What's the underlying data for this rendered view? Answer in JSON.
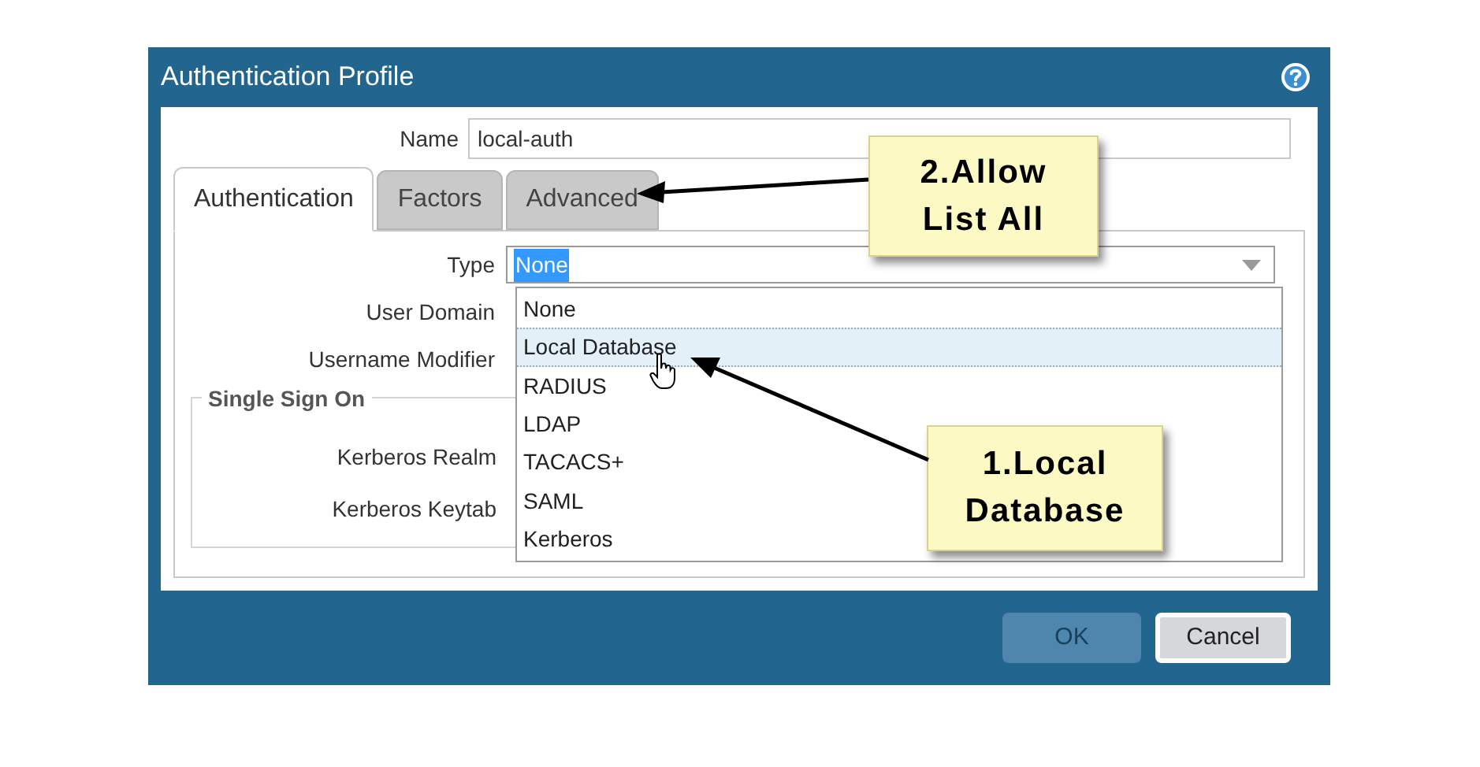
{
  "dialog": {
    "title": "Authentication Profile"
  },
  "name_field": {
    "label": "Name",
    "value": "local-auth"
  },
  "tabs": [
    {
      "label": "Authentication",
      "selected": true
    },
    {
      "label": "Factors",
      "selected": false
    },
    {
      "label": "Advanced",
      "selected": false
    }
  ],
  "form": {
    "type": {
      "label": "Type",
      "value": "None",
      "expanded": true
    },
    "labels": [
      "User Domain",
      "Username Modifier"
    ],
    "single_sign_on": {
      "title": "Single Sign On",
      "labels": [
        "Kerberos Realm",
        "Kerberos Keytab"
      ]
    }
  },
  "dropdown_options": [
    {
      "label": "None",
      "selected": false
    },
    {
      "label": "Local Database",
      "selected": true
    },
    {
      "label": "RADIUS",
      "selected": false
    },
    {
      "label": "LDAP",
      "selected": false
    },
    {
      "label": "TACACS+",
      "selected": false
    },
    {
      "label": "SAML",
      "selected": false
    },
    {
      "label": "Kerberos",
      "selected": false
    }
  ],
  "callouts": [
    {
      "text": "2.Allow List All"
    },
    {
      "text": "1.Local Database"
    }
  ],
  "buttons": [
    {
      "label": "OK",
      "disabled": true
    },
    {
      "label": "Cancel",
      "disabled": false
    }
  ]
}
